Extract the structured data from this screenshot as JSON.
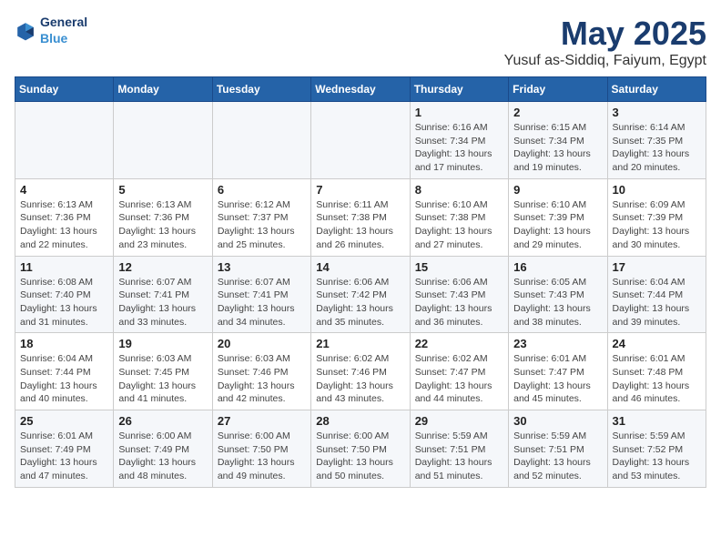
{
  "logo": {
    "text_general": "General",
    "text_blue": "Blue"
  },
  "title": "May 2025",
  "subtitle": "Yusuf as-Siddiq, Faiyum, Egypt",
  "header_days": [
    "Sunday",
    "Monday",
    "Tuesday",
    "Wednesday",
    "Thursday",
    "Friday",
    "Saturday"
  ],
  "weeks": [
    {
      "days": [
        {
          "number": "",
          "info": ""
        },
        {
          "number": "",
          "info": ""
        },
        {
          "number": "",
          "info": ""
        },
        {
          "number": "",
          "info": ""
        },
        {
          "number": "1",
          "info": "Sunrise: 6:16 AM\nSunset: 7:34 PM\nDaylight: 13 hours\nand 17 minutes."
        },
        {
          "number": "2",
          "info": "Sunrise: 6:15 AM\nSunset: 7:34 PM\nDaylight: 13 hours\nand 19 minutes."
        },
        {
          "number": "3",
          "info": "Sunrise: 6:14 AM\nSunset: 7:35 PM\nDaylight: 13 hours\nand 20 minutes."
        }
      ]
    },
    {
      "days": [
        {
          "number": "4",
          "info": "Sunrise: 6:13 AM\nSunset: 7:36 PM\nDaylight: 13 hours\nand 22 minutes."
        },
        {
          "number": "5",
          "info": "Sunrise: 6:13 AM\nSunset: 7:36 PM\nDaylight: 13 hours\nand 23 minutes."
        },
        {
          "number": "6",
          "info": "Sunrise: 6:12 AM\nSunset: 7:37 PM\nDaylight: 13 hours\nand 25 minutes."
        },
        {
          "number": "7",
          "info": "Sunrise: 6:11 AM\nSunset: 7:38 PM\nDaylight: 13 hours\nand 26 minutes."
        },
        {
          "number": "8",
          "info": "Sunrise: 6:10 AM\nSunset: 7:38 PM\nDaylight: 13 hours\nand 27 minutes."
        },
        {
          "number": "9",
          "info": "Sunrise: 6:10 AM\nSunset: 7:39 PM\nDaylight: 13 hours\nand 29 minutes."
        },
        {
          "number": "10",
          "info": "Sunrise: 6:09 AM\nSunset: 7:39 PM\nDaylight: 13 hours\nand 30 minutes."
        }
      ]
    },
    {
      "days": [
        {
          "number": "11",
          "info": "Sunrise: 6:08 AM\nSunset: 7:40 PM\nDaylight: 13 hours\nand 31 minutes."
        },
        {
          "number": "12",
          "info": "Sunrise: 6:07 AM\nSunset: 7:41 PM\nDaylight: 13 hours\nand 33 minutes."
        },
        {
          "number": "13",
          "info": "Sunrise: 6:07 AM\nSunset: 7:41 PM\nDaylight: 13 hours\nand 34 minutes."
        },
        {
          "number": "14",
          "info": "Sunrise: 6:06 AM\nSunset: 7:42 PM\nDaylight: 13 hours\nand 35 minutes."
        },
        {
          "number": "15",
          "info": "Sunrise: 6:06 AM\nSunset: 7:43 PM\nDaylight: 13 hours\nand 36 minutes."
        },
        {
          "number": "16",
          "info": "Sunrise: 6:05 AM\nSunset: 7:43 PM\nDaylight: 13 hours\nand 38 minutes."
        },
        {
          "number": "17",
          "info": "Sunrise: 6:04 AM\nSunset: 7:44 PM\nDaylight: 13 hours\nand 39 minutes."
        }
      ]
    },
    {
      "days": [
        {
          "number": "18",
          "info": "Sunrise: 6:04 AM\nSunset: 7:44 PM\nDaylight: 13 hours\nand 40 minutes."
        },
        {
          "number": "19",
          "info": "Sunrise: 6:03 AM\nSunset: 7:45 PM\nDaylight: 13 hours\nand 41 minutes."
        },
        {
          "number": "20",
          "info": "Sunrise: 6:03 AM\nSunset: 7:46 PM\nDaylight: 13 hours\nand 42 minutes."
        },
        {
          "number": "21",
          "info": "Sunrise: 6:02 AM\nSunset: 7:46 PM\nDaylight: 13 hours\nand 43 minutes."
        },
        {
          "number": "22",
          "info": "Sunrise: 6:02 AM\nSunset: 7:47 PM\nDaylight: 13 hours\nand 44 minutes."
        },
        {
          "number": "23",
          "info": "Sunrise: 6:01 AM\nSunset: 7:47 PM\nDaylight: 13 hours\nand 45 minutes."
        },
        {
          "number": "24",
          "info": "Sunrise: 6:01 AM\nSunset: 7:48 PM\nDaylight: 13 hours\nand 46 minutes."
        }
      ]
    },
    {
      "days": [
        {
          "number": "25",
          "info": "Sunrise: 6:01 AM\nSunset: 7:49 PM\nDaylight: 13 hours\nand 47 minutes."
        },
        {
          "number": "26",
          "info": "Sunrise: 6:00 AM\nSunset: 7:49 PM\nDaylight: 13 hours\nand 48 minutes."
        },
        {
          "number": "27",
          "info": "Sunrise: 6:00 AM\nSunset: 7:50 PM\nDaylight: 13 hours\nand 49 minutes."
        },
        {
          "number": "28",
          "info": "Sunrise: 6:00 AM\nSunset: 7:50 PM\nDaylight: 13 hours\nand 50 minutes."
        },
        {
          "number": "29",
          "info": "Sunrise: 5:59 AM\nSunset: 7:51 PM\nDaylight: 13 hours\nand 51 minutes."
        },
        {
          "number": "30",
          "info": "Sunrise: 5:59 AM\nSunset: 7:51 PM\nDaylight: 13 hours\nand 52 minutes."
        },
        {
          "number": "31",
          "info": "Sunrise: 5:59 AM\nSunset: 7:52 PM\nDaylight: 13 hours\nand 53 minutes."
        }
      ]
    }
  ]
}
